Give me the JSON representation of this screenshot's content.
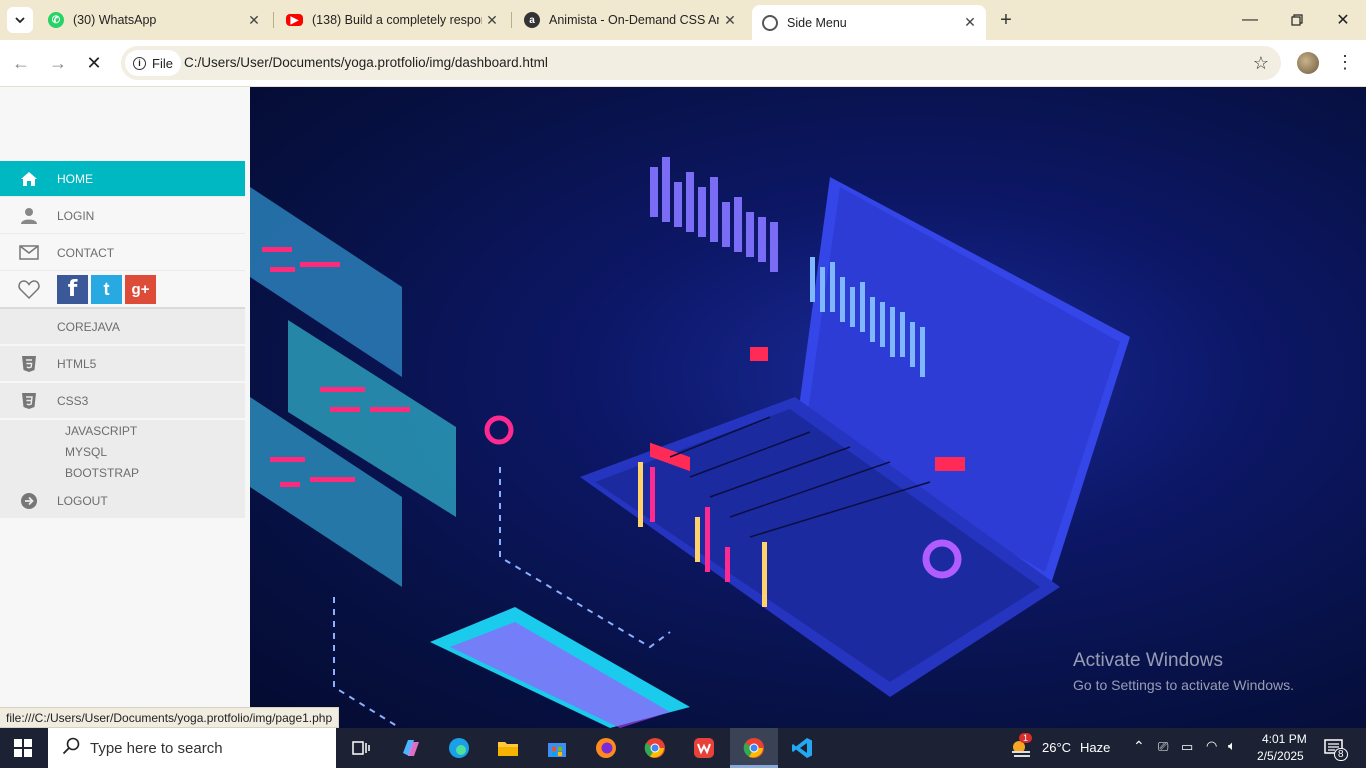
{
  "browser": {
    "tabs": [
      {
        "title": "(30) WhatsApp",
        "favicon": "whatsapp-icon"
      },
      {
        "title": "(138) Build a completely respon",
        "favicon": "youtube-icon"
      },
      {
        "title": "Animista - On-Demand CSS An",
        "favicon": "animista-icon"
      },
      {
        "title": "Side Menu",
        "favicon": "page-icon"
      }
    ],
    "chip_label": "File",
    "url": "C:/Users/User/Documents/yoga.protfolio/img/dashboard.html",
    "status_url": "file:///C:/Users/User/Documents/yoga.protfolio/img/page1.php"
  },
  "sidebar": {
    "home": "HOME",
    "login": "LOGIN",
    "contact": "CONTACT",
    "corejava": "COREJAVA",
    "html5": "HTML5",
    "css3": "CSS3",
    "sub": [
      "JAVASCRIPT",
      "MYSQL",
      "BOOTSTRAP"
    ],
    "logout": "LOGOUT",
    "accent": "#00b8c2"
  },
  "watermark": {
    "line1": "Activate Windows",
    "line2": "Go to Settings to activate Windows."
  },
  "taskbar": {
    "search_placeholder": "Type here to search",
    "weather": "26°C",
    "weather_desc": "Haze",
    "time": "4:01 PM",
    "date": "2/5/2025",
    "weather_badge": "1",
    "notifications": "8"
  }
}
